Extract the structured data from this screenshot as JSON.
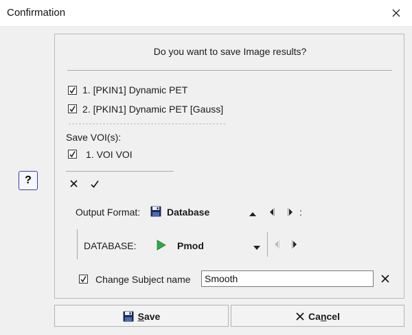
{
  "window": {
    "title": "Confirmation"
  },
  "dialog": {
    "question": "Do you want to save Image results?",
    "images": [
      {
        "label": "1. [PKIN1] Dynamic PET",
        "checked": true
      },
      {
        "label": "2. [PKIN1] Dynamic PET [Gauss]",
        "checked": true
      }
    ],
    "voi_heading": "Save VOI(s):",
    "vois": [
      {
        "label": "1. VOI VOI",
        "checked": true
      }
    ],
    "output_format_label": "Output Format:",
    "output_format_value": "Database",
    "output_format_suffix": ":",
    "database_label": "DATABASE:",
    "database_value": "Pmod",
    "change_subject": {
      "label": "Change Subject name",
      "checked": true,
      "value": "Smooth"
    }
  },
  "help": {
    "label": "?"
  },
  "buttons": {
    "save": {
      "first": "S",
      "rest": "ave"
    },
    "cancel": {
      "first": "C",
      "mid": "a",
      "ul": "n",
      "rest": "cel"
    }
  },
  "colors": {
    "accent": "#3a3aa0",
    "db_arrow": "#2eaa44"
  }
}
